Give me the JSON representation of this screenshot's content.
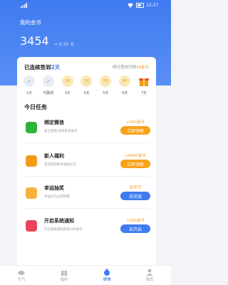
{
  "status_bar": {
    "time": "12:27"
  },
  "wallet": {
    "label": "我的金币",
    "coins": "3454",
    "cash": "≈ 0.35 元"
  },
  "checkin": {
    "streak_prefix": "已连续签到",
    "streak_days": "2天",
    "tomorrow_prefix": "明日签到可得",
    "tomorrow_amount": "38金币",
    "days": [
      {
        "coin": "✓",
        "label": "1天"
      },
      {
        "coin": "✓",
        "label": "可翻倍"
      },
      {
        "coin": "38",
        "label": "3天"
      },
      {
        "coin": "58",
        "label": "4天"
      },
      {
        "coin": "68",
        "label": "5天"
      },
      {
        "coin": "88",
        "label": "6天"
      },
      {
        "coin": "gift-icon",
        "label": "7天"
      }
    ]
  },
  "tasks": {
    "title": "今日任务",
    "items": [
      {
        "name": "绑定微信",
        "desc": "安全登陆 获得更多金币",
        "reward": "+100金币",
        "button": "立即领取",
        "icon_color": "#2db33a",
        "btn_style": "orange"
      },
      {
        "name": "新人福利",
        "desc": "首次提现即享现金红包",
        "reward": "+6000金币",
        "button": "立即领取",
        "icon_color": "#f39a1a",
        "btn_style": "orange"
      },
      {
        "name": "幸运抽奖",
        "desc": "幸运红包立刻领取",
        "reward": "拼手气",
        "button": "去完成",
        "icon_color": "#f7b23b",
        "btn_style": "blue"
      },
      {
        "name": "开启系统通知",
        "desc": "开启系统通知获取100金币",
        "reward": "+100金币",
        "button": "去开启",
        "icon_color": "#e8455a",
        "btn_style": "blue"
      }
    ]
  },
  "tabbar": [
    {
      "label": "天气",
      "icon": "weather-icon"
    },
    {
      "label": "福利",
      "icon": "gift-icon"
    },
    {
      "label": "赚赚",
      "icon": "money-bag-icon",
      "active": true
    },
    {
      "label": "我的",
      "icon": "profile-icon"
    }
  ]
}
